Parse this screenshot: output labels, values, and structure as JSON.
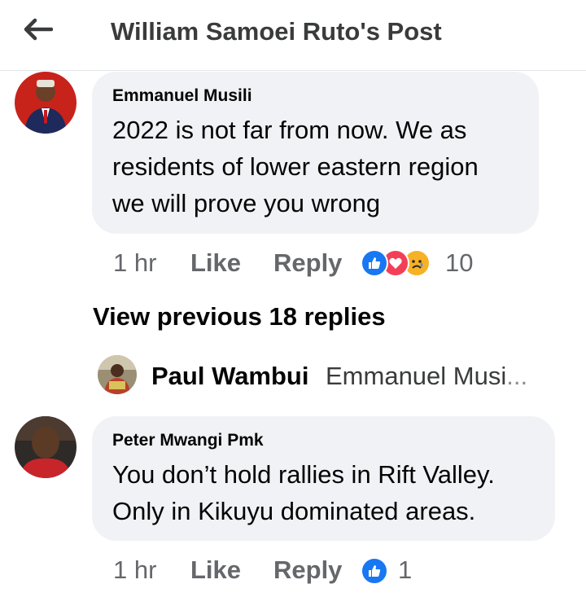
{
  "header": {
    "title": "William Samoei Ruto's Post",
    "back_icon": "arrow-left-icon"
  },
  "comments": [
    {
      "author": "Emmanuel Musili",
      "text_lines": [
        "2022 is not far from now. We as",
        "residents of lower eastern region",
        "we will prove you wrong"
      ],
      "time": "1 hr",
      "like_label": "Like",
      "reply_label": "Reply",
      "reactions": [
        "like-reaction-icon",
        "love-reaction-icon",
        "sad-reaction-icon"
      ],
      "reaction_count": "10"
    },
    {
      "author": "Peter Mwangi Pmk",
      "text_lines": [
        "You don’t hold rallies in Rift Valley.",
        "Only in Kikuyu dominated areas."
      ],
      "time": "1 hr",
      "like_label": "Like",
      "reply_label": "Reply",
      "reactions": [
        "like-reaction-icon"
      ],
      "reaction_count": "1"
    }
  ],
  "view_previous": "View previous 18 replies",
  "reply_preview": {
    "author": "Paul Wambui",
    "snippet": "Emmanuel Musi",
    "ellipsis": "..."
  },
  "colors": {
    "like_blue": "#1877f2",
    "love_red": "#f33e58",
    "sad_yellow": "#f7b125",
    "meta_gray": "#65676b",
    "bubble_bg": "#f0f2f5"
  }
}
